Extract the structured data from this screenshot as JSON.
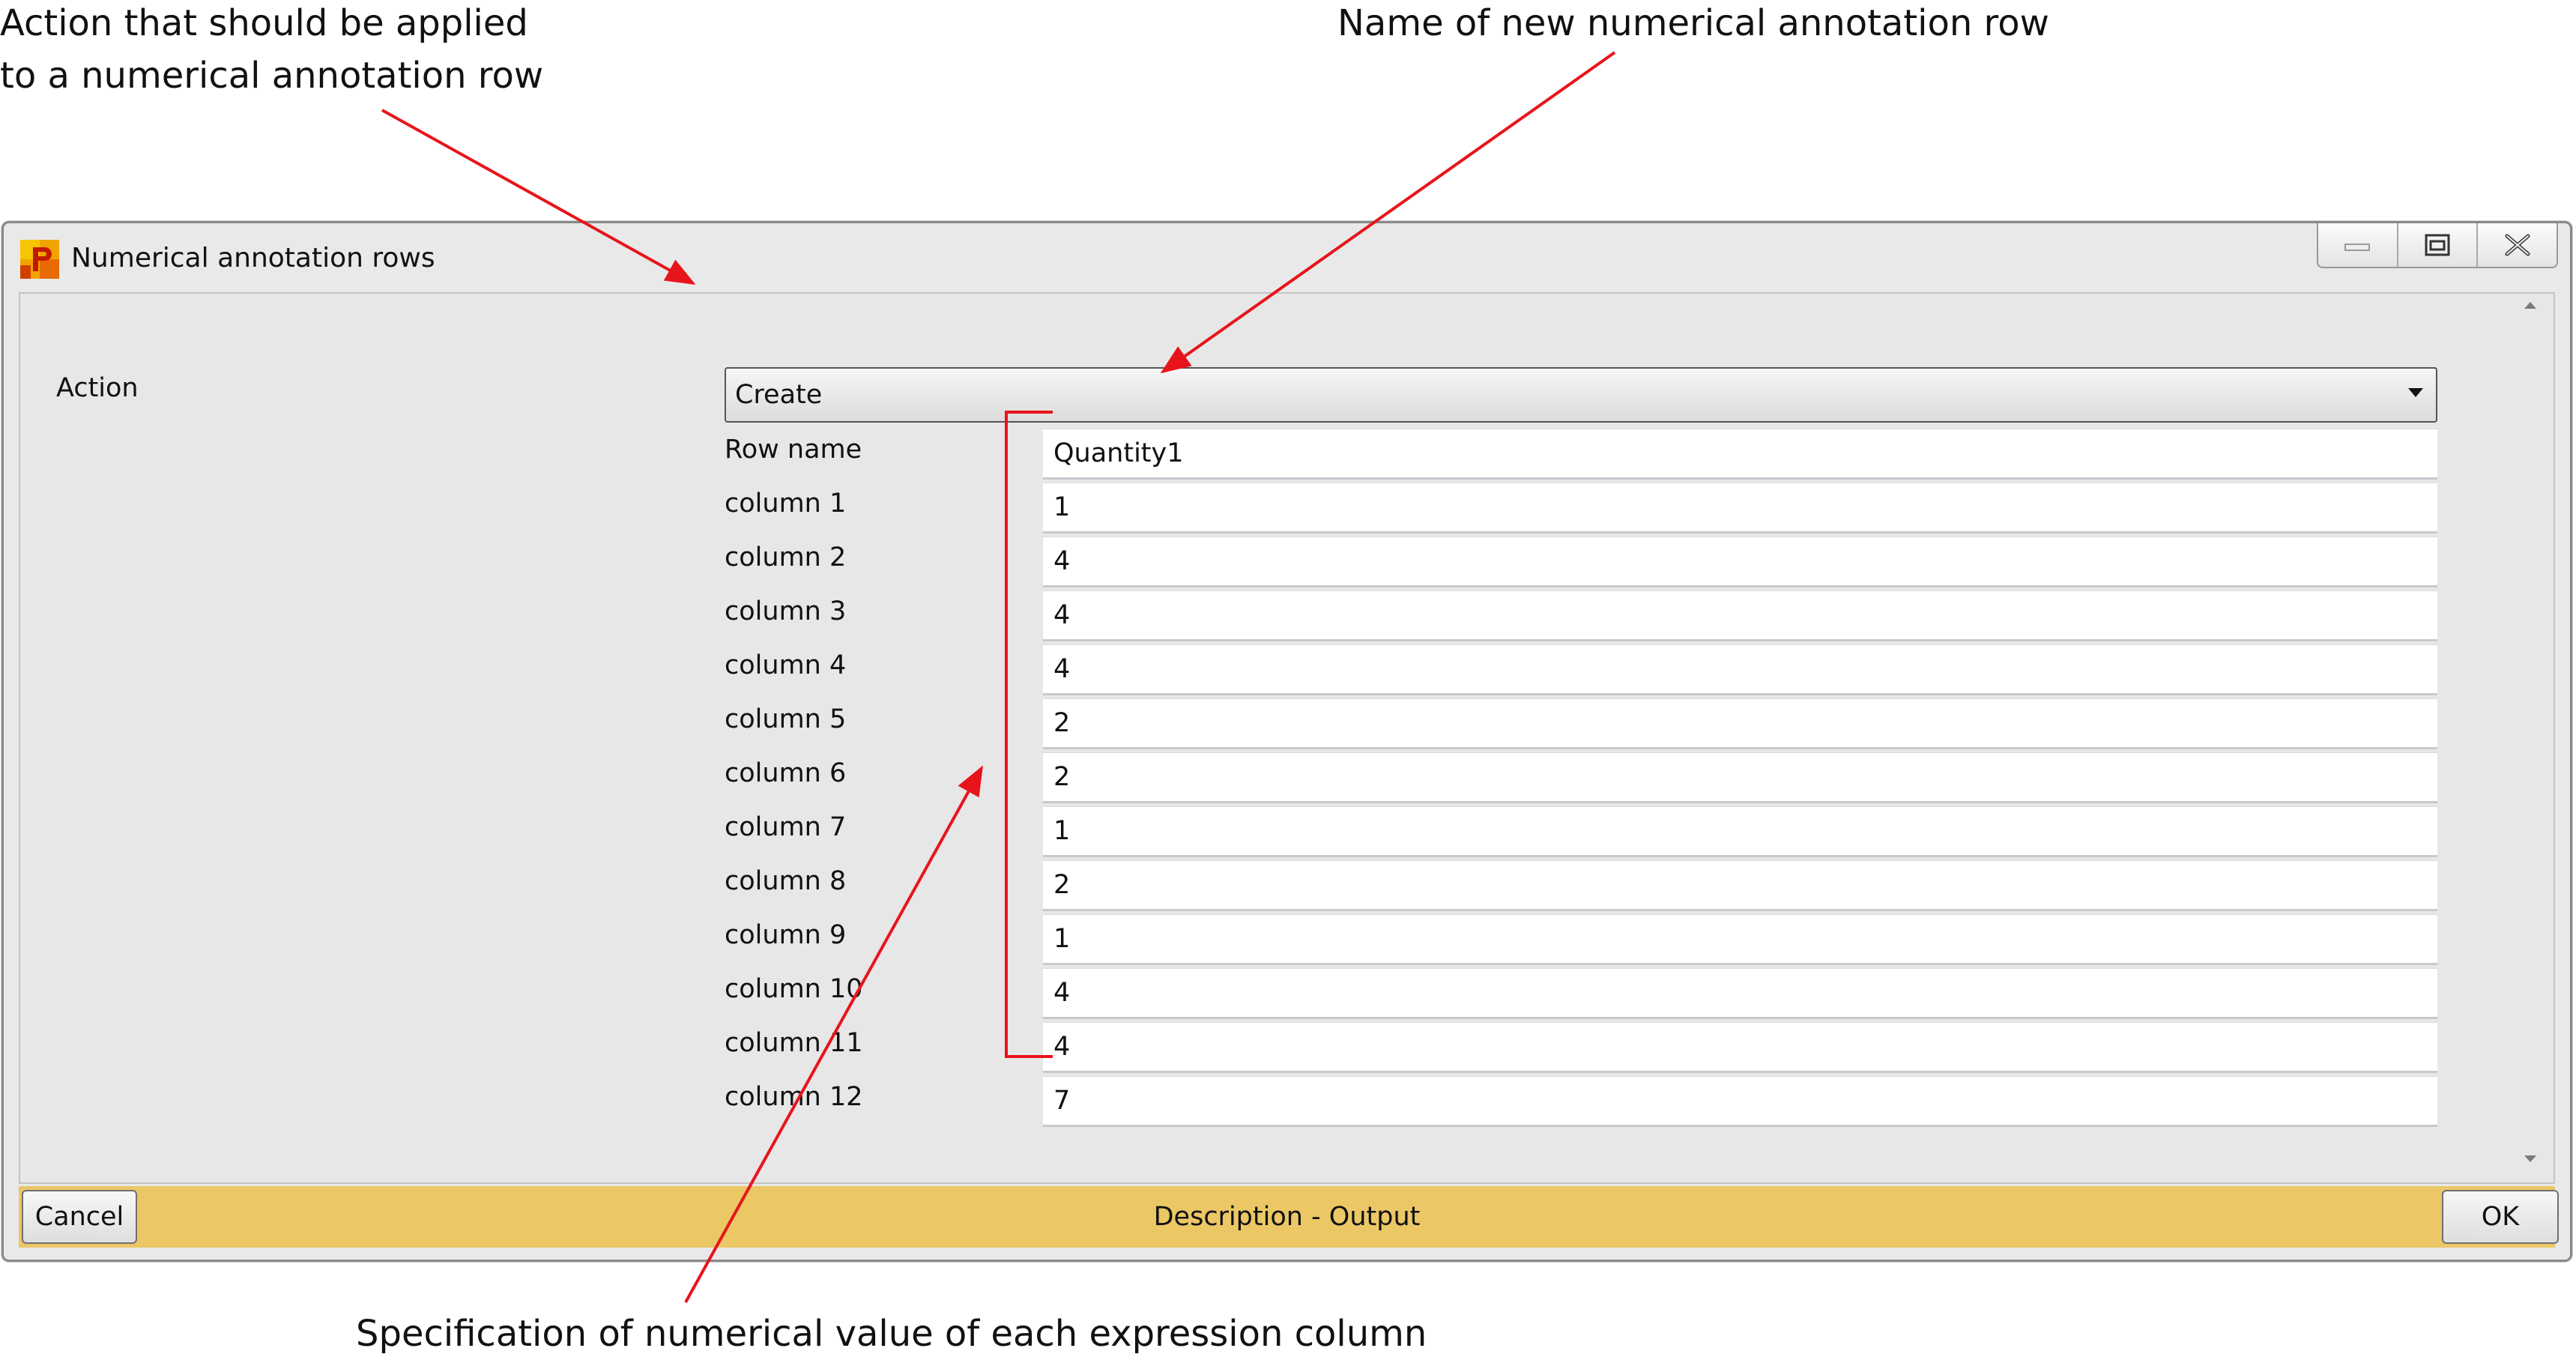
{
  "callouts": {
    "top_left_line1": "Action that should be applied",
    "top_left_line2": "to a numerical annotation row",
    "top_right": "Name of new numerical annotation row",
    "bottom": "Specification of numerical value of each expression column"
  },
  "window": {
    "title": "Numerical annotation rows",
    "icon": "app-logo-icon",
    "controls": [
      "minimize-icon",
      "maximize-icon",
      "close-icon"
    ]
  },
  "form": {
    "action_label": "Action",
    "action_value": "Create",
    "row_name_label": "Row name",
    "row_name_value": "Quantity1",
    "columns": [
      {
        "label": "column 1",
        "value": "1"
      },
      {
        "label": "column 2",
        "value": "4"
      },
      {
        "label": "column 3",
        "value": "4"
      },
      {
        "label": "column 4",
        "value": "4"
      },
      {
        "label": "column 5",
        "value": "2"
      },
      {
        "label": "column 6",
        "value": "2"
      },
      {
        "label": "column 7",
        "value": "1"
      },
      {
        "label": "column 8",
        "value": "2"
      },
      {
        "label": "column 9",
        "value": "1"
      },
      {
        "label": "column 10",
        "value": "4"
      },
      {
        "label": "column 11",
        "value": "4"
      },
      {
        "label": "column 12",
        "value": "7"
      }
    ]
  },
  "footer": {
    "cancel_label": "Cancel",
    "description": "Description - Output",
    "ok_label": "OK"
  },
  "colors": {
    "footer_bar": "#ebc766",
    "annotation_arrow": "#e8141b",
    "window_bg": "#e9e9e9"
  }
}
